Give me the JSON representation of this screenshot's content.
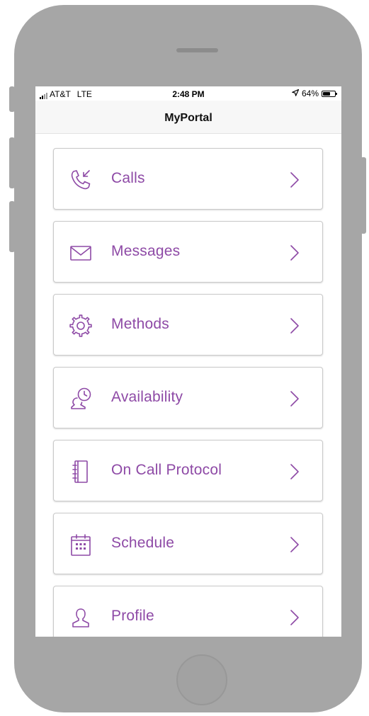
{
  "status_bar": {
    "carrier": "AT&T",
    "network": "LTE",
    "time": "2:48 PM",
    "battery_percent": "64%",
    "battery_level": 0.64,
    "location_icon": "location-arrow-icon"
  },
  "navbar": {
    "title": "MyPortal"
  },
  "colors": {
    "accent": "#8e4aa6",
    "frame": "#a6a6a6"
  },
  "menu": {
    "items": [
      {
        "label": "Calls",
        "icon": "phone-incoming-icon"
      },
      {
        "label": "Messages",
        "icon": "envelope-icon"
      },
      {
        "label": "Methods",
        "icon": "gear-icon"
      },
      {
        "label": "Availability",
        "icon": "person-clock-icon"
      },
      {
        "label": "On Call Protocol",
        "icon": "notebook-icon"
      },
      {
        "label": "Schedule",
        "icon": "calendar-icon"
      },
      {
        "label": "Profile",
        "icon": "user-icon"
      }
    ]
  }
}
